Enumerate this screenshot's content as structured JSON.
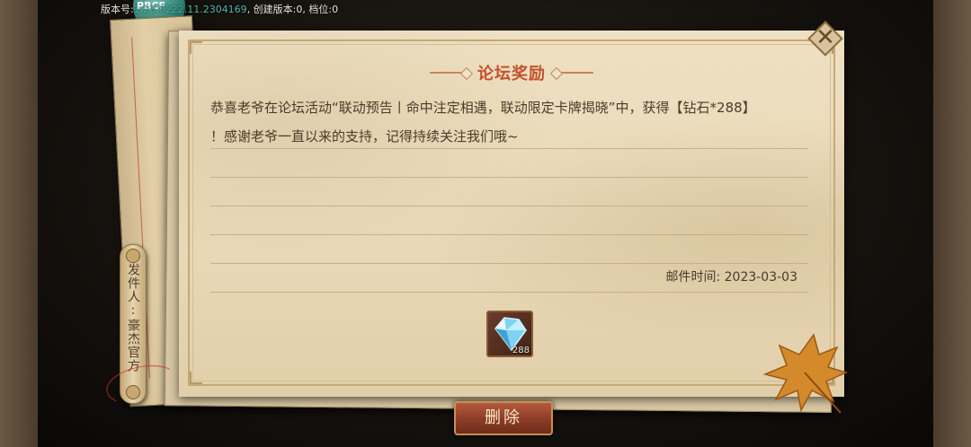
{
  "version_bar": {
    "prefix": "版本号:",
    "version": "1.23.0222.11.2304169",
    "rest": ", 创建版本:0, 档位:0",
    "badge": "PBCF"
  },
  "mail": {
    "title": "论坛奖励",
    "body_line1": "恭喜老爷在论坛活动“联动预告丨命中注定相遇，联动限定卡牌揭晓”中，获得【钻石*288】",
    "body_line2": "！感谢老爷一直以来的支持，记得持续关注我们哦~",
    "time_label": "邮件时间:",
    "time_value": "2023-03-03",
    "sender": "发件人:豪杰官方",
    "reward": {
      "icon": "diamond-icon",
      "count": "288"
    }
  },
  "buttons": {
    "delete_label": "删除",
    "close_icon": "close-icon"
  },
  "colors": {
    "title": "#c4512a",
    "body_text": "#4c3b2a",
    "paper": "#e8d8b6",
    "delete_button": "#8f3e27"
  }
}
